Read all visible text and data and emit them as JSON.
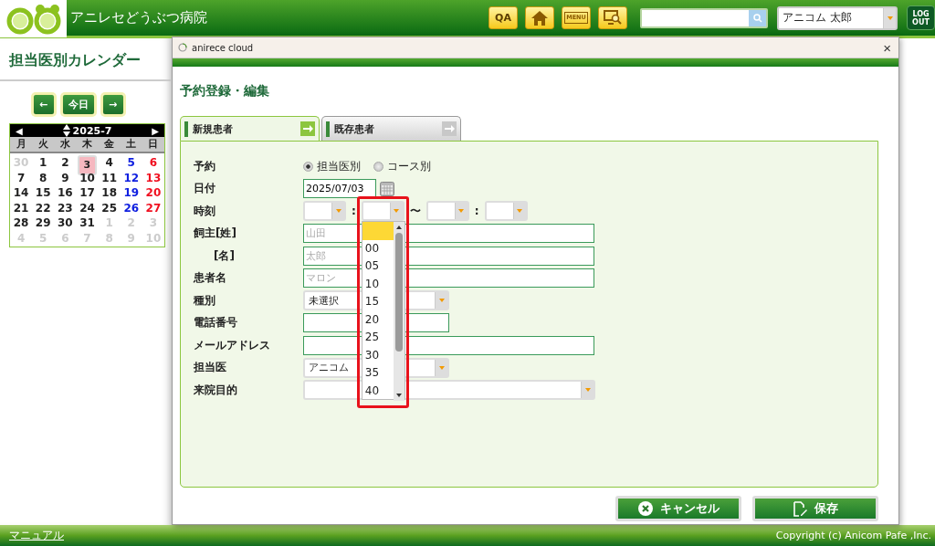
{
  "header": {
    "hospital_name": "アニレセどうぶつ病院",
    "toolbar": [
      {
        "kind": "text",
        "label": "QA"
      },
      {
        "kind": "home"
      },
      {
        "kind": "menu",
        "label": "MENU"
      },
      {
        "kind": "monitor"
      }
    ],
    "user_select": {
      "value": "アニコム 太郎"
    },
    "logout": {
      "lines": [
        "LOG",
        "OUT"
      ]
    }
  },
  "page_title": "担当医別カレンダー",
  "calendar": {
    "nav": [
      {
        "label": "←"
      },
      {
        "label": "今日"
      },
      {
        "label": "→"
      }
    ],
    "prev": "◀",
    "month": "2025-7",
    "next": "▶",
    "weekdays": [
      "月",
      "火",
      "水",
      "木",
      "金",
      "土",
      "日"
    ],
    "weeks": [
      [
        {
          "day": "30",
          "kind": "muted",
          "selected": false
        },
        {
          "day": "1",
          "kind": "normal",
          "selected": false
        },
        {
          "day": "2",
          "kind": "normal",
          "selected": false
        },
        {
          "day": "3",
          "kind": "normal",
          "selected": true
        },
        {
          "day": "4",
          "kind": "normal",
          "selected": false
        },
        {
          "day": "5",
          "kind": "saturday",
          "selected": false
        },
        {
          "day": "6",
          "kind": "sunday",
          "selected": false
        }
      ],
      [
        {
          "day": "7",
          "kind": "normal",
          "selected": false
        },
        {
          "day": "8",
          "kind": "normal",
          "selected": false
        },
        {
          "day": "9",
          "kind": "normal",
          "selected": false
        },
        {
          "day": "10",
          "kind": "normal",
          "selected": false
        },
        {
          "day": "11",
          "kind": "normal",
          "selected": false
        },
        {
          "day": "12",
          "kind": "saturday",
          "selected": false
        },
        {
          "day": "13",
          "kind": "sunday",
          "selected": false
        }
      ],
      [
        {
          "day": "14",
          "kind": "normal",
          "selected": false
        },
        {
          "day": "15",
          "kind": "normal",
          "selected": false
        },
        {
          "day": "16",
          "kind": "normal",
          "selected": false
        },
        {
          "day": "17",
          "kind": "normal",
          "selected": false
        },
        {
          "day": "18",
          "kind": "normal",
          "selected": false
        },
        {
          "day": "19",
          "kind": "saturday",
          "selected": false
        },
        {
          "day": "20",
          "kind": "sunday",
          "selected": false
        }
      ],
      [
        {
          "day": "21",
          "kind": "normal",
          "selected": false
        },
        {
          "day": "22",
          "kind": "normal",
          "selected": false
        },
        {
          "day": "23",
          "kind": "normal",
          "selected": false
        },
        {
          "day": "24",
          "kind": "normal",
          "selected": false
        },
        {
          "day": "25",
          "kind": "normal",
          "selected": false
        },
        {
          "day": "26",
          "kind": "saturday",
          "selected": false
        },
        {
          "day": "27",
          "kind": "sunday",
          "selected": false
        }
      ],
      [
        {
          "day": "28",
          "kind": "normal",
          "selected": false
        },
        {
          "day": "29",
          "kind": "normal",
          "selected": false
        },
        {
          "day": "30",
          "kind": "normal",
          "selected": false
        },
        {
          "day": "31",
          "kind": "normal",
          "selected": false
        },
        {
          "day": "1",
          "kind": "muted",
          "selected": false
        },
        {
          "day": "2",
          "kind": "muted",
          "selected": false
        },
        {
          "day": "3",
          "kind": "muted",
          "selected": false
        }
      ],
      [
        {
          "day": "4",
          "kind": "muted",
          "selected": false
        },
        {
          "day": "5",
          "kind": "muted",
          "selected": false
        },
        {
          "day": "6",
          "kind": "muted",
          "selected": false
        },
        {
          "day": "7",
          "kind": "muted",
          "selected": false
        },
        {
          "day": "8",
          "kind": "muted",
          "selected": false
        },
        {
          "day": "9",
          "kind": "muted",
          "selected": false
        },
        {
          "day": "10",
          "kind": "muted",
          "selected": false
        }
      ]
    ]
  },
  "footer": {
    "manual_link": "マニュアル",
    "copyright": "Copyright (c) Anicom Pafe ,Inc."
  },
  "dialog": {
    "window_title": "anirece cloud",
    "close": "×",
    "heading": "予約登録・編集",
    "tabs": [
      {
        "label": "新規患者",
        "selected": true
      },
      {
        "label": "既存患者",
        "selected": false
      }
    ],
    "fields": [
      {
        "kind": "radio",
        "label": "予約",
        "indented": false,
        "options": [
          {
            "label": "担当医別",
            "selected": true
          },
          {
            "label": "コース別",
            "selected": false
          }
        ]
      },
      {
        "kind": "date",
        "label": "日付",
        "indented": false,
        "value": "2025/07/03"
      },
      {
        "kind": "time",
        "label": "時刻",
        "indented": false,
        "separators": [
          ":",
          "〜",
          ":"
        ],
        "selects": [
          {
            "open": false
          },
          {
            "open": true
          },
          {
            "open": false
          },
          {
            "open": false
          }
        ]
      },
      {
        "kind": "input",
        "label": "飼主[姓]",
        "indented": false,
        "placeholder": "山田"
      },
      {
        "kind": "input",
        "label": "[名]",
        "indented": true,
        "placeholder": "太郎"
      },
      {
        "kind": "input",
        "label": "患者名",
        "indented": false,
        "placeholder": "マロン"
      },
      {
        "kind": "short_select",
        "label": "種別",
        "indented": false,
        "value": "未選択"
      },
      {
        "kind": "short_input",
        "label": "電話番号",
        "indented": false
      },
      {
        "kind": "input",
        "label": "メールアドレス",
        "indented": false
      },
      {
        "kind": "short_select",
        "label": "担当医",
        "indented": false,
        "value": "アニコム"
      },
      {
        "kind": "select",
        "label": "来院目的",
        "indented": false
      }
    ],
    "dropdown_options": [
      {
        "selected": true
      },
      {
        "label": "00",
        "selected": false
      },
      {
        "label": "05",
        "selected": false
      },
      {
        "label": "10",
        "selected": false
      },
      {
        "label": "15",
        "selected": false
      },
      {
        "label": "20",
        "selected": false
      },
      {
        "label": "25",
        "selected": false
      },
      {
        "label": "30",
        "selected": false
      },
      {
        "label": "35",
        "selected": false
      },
      {
        "label": "40",
        "selected": false
      }
    ],
    "buttons": [
      {
        "kind": "cancel",
        "label": "キャンセル"
      },
      {
        "kind": "save",
        "label": "保存"
      }
    ]
  }
}
